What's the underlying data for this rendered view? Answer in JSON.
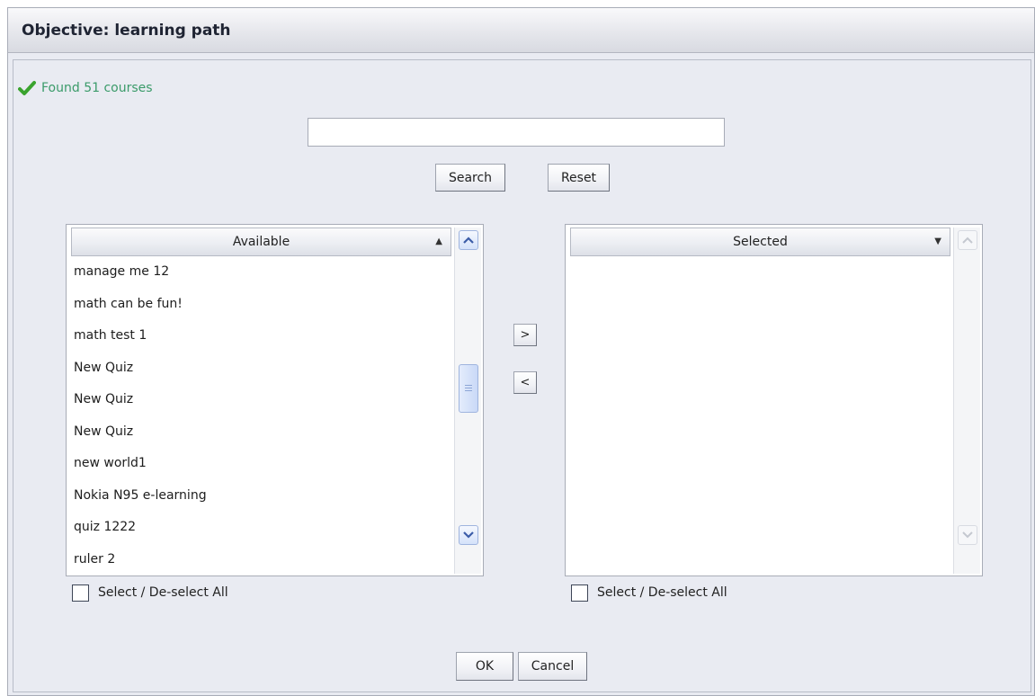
{
  "dialog": {
    "title": "Objective: learning path"
  },
  "status": {
    "icon": "check-icon",
    "text": "Found 51 courses",
    "color": "#3b9b6a"
  },
  "search": {
    "value": "",
    "placeholder": "",
    "search_label": "Search",
    "reset_label": "Reset"
  },
  "available": {
    "header": "Available",
    "sort_icon": "sort-up-icon",
    "items": [
      "manage me 12",
      "math can be fun!",
      "math test 1",
      "New Quiz",
      "New Quiz",
      "New Quiz",
      "new world1",
      "Nokia N95 e-learning",
      "quiz 1222",
      "ruler 2"
    ],
    "select_all_label": "Select / De-select All",
    "select_all_checked": false
  },
  "selected": {
    "header": "Selected",
    "sort_icon": "sort-down-icon",
    "items": [],
    "select_all_label": "Select / De-select All",
    "select_all_checked": false
  },
  "transfer": {
    "add_label": ">",
    "remove_label": "<"
  },
  "footer": {
    "ok_label": "OK",
    "cancel_label": "Cancel"
  }
}
